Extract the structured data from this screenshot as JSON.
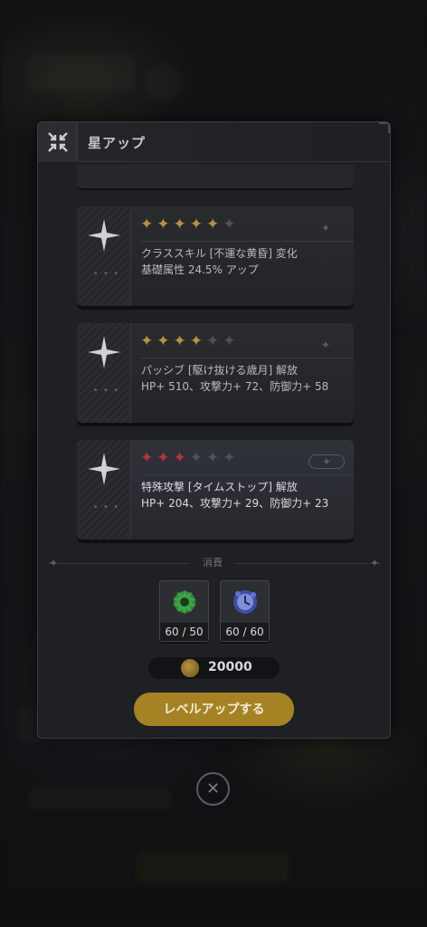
{
  "dialog": {
    "title": "星アップ",
    "cost_label": "消費",
    "gold_amount": "20000",
    "levelup_label": "レベルアップする"
  },
  "star_cards": [
    {
      "stars": [
        "gold",
        "gold",
        "gold",
        "gold",
        "gold",
        "empty"
      ],
      "line1": "クラススキル [不運な黄昏] 変化",
      "line2": "基礎属性 24.5% アップ"
    },
    {
      "stars": [
        "gold",
        "gold",
        "gold",
        "gold",
        "empty",
        "empty"
      ],
      "line1": "パッシブ [駆け抜ける歳月] 解放",
      "line2": "HP+ 510、攻撃力+ 72、防御力+ 58"
    },
    {
      "stars": [
        "red",
        "red",
        "red",
        "empty",
        "empty",
        "empty"
      ],
      "line1": "特殊攻撃 [タイムストップ] 解放",
      "line2": "HP+ 204、攻撃力+ 29、防御力+ 23"
    }
  ],
  "materials": [
    {
      "icon": "green-gear-material-icon",
      "count": "60 / 50",
      "color": "#2f8a3a"
    },
    {
      "icon": "blue-clock-material-icon",
      "count": "60 / 60",
      "color": "#4a63c4"
    }
  ],
  "colors": {
    "accent_gold": "#a58224",
    "star_gold": "#b8933f",
    "star_red": "#b8343a"
  }
}
